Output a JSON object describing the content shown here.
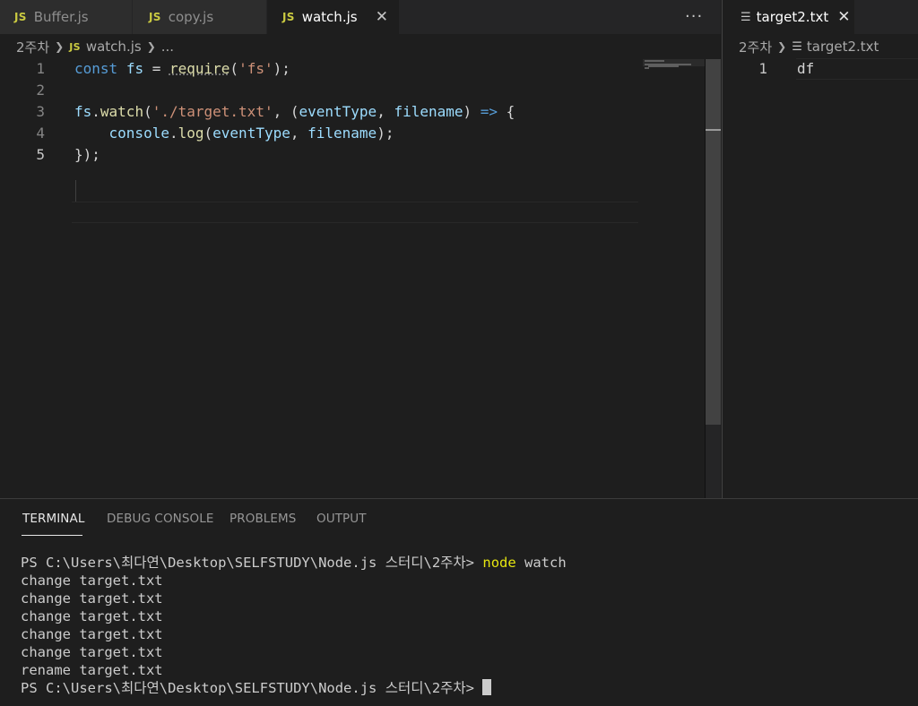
{
  "colors": {
    "editor_bg": "#1e1e1e",
    "tabbar_bg": "#252526",
    "inactive_tab_bg": "#2d2d2d",
    "js_badge": "#cbcb41",
    "keyword": "#569cd6",
    "variable": "#9cdcfe",
    "function": "#dcdcaa",
    "string": "#ce9178",
    "terminal_command": "#e5e510"
  },
  "left_editor": {
    "tabs": [
      {
        "badge": "JS",
        "label": "Buffer.js",
        "active": false
      },
      {
        "badge": "JS",
        "label": "copy.js",
        "active": false
      },
      {
        "badge": "JS",
        "label": "watch.js",
        "active": true,
        "close_icon": "close-icon"
      }
    ],
    "more_actions": "···",
    "breadcrumb": {
      "folder": "2주차",
      "separator_icon": "chevron-right-icon",
      "file_badge": "JS",
      "file": "watch.js",
      "ellipsis": "..."
    },
    "line_numbers": [
      "1",
      "2",
      "3",
      "4",
      "5"
    ],
    "code": {
      "l1": {
        "kw": "const",
        "sp1": " ",
        "var": "fs",
        "op": " = ",
        "fn": "require",
        "p1": "(",
        "str": "'fs'",
        "p2": ");"
      },
      "l3": {
        "obj": "fs",
        "dot": ".",
        "fn": "watch",
        "p1": "(",
        "str": "'./target.txt'",
        "c1": ", (",
        "a1": "eventType",
        "c2": ", ",
        "a2": "filename",
        "p2": ") ",
        "arrow": "=>",
        "brace": " {"
      },
      "l4": {
        "indent": "    ",
        "obj": "console",
        "dot": ".",
        "fn": "log",
        "p1": "(",
        "a1": "eventType",
        "c1": ", ",
        "a2": "filename",
        "p2": ");"
      },
      "l5": {
        "close": "});"
      }
    }
  },
  "right_editor": {
    "tab": {
      "icon": "file-lines-icon",
      "label": "target2.txt",
      "close": "✕"
    },
    "breadcrumb": {
      "folder": "2주차",
      "file": "target2.txt"
    },
    "line_numbers": [
      "1"
    ],
    "content": [
      "df"
    ]
  },
  "panel": {
    "tabs": [
      "TERMINAL",
      "DEBUG CONSOLE",
      "PROBLEMS",
      "OUTPUT"
    ],
    "active_tab": "TERMINAL",
    "terminal": {
      "prompt": "PS C:\\Users\\최다연\\Desktop\\SELFSTUDY\\Node.js 스터디\\2주차> ",
      "command": "node",
      "command_arg": " watch",
      "output": [
        "change target.txt",
        "change target.txt",
        "change target.txt",
        "change target.txt",
        "change target.txt",
        "rename target.txt"
      ],
      "final_prompt": "PS C:\\Users\\최다연\\Desktop\\SELFSTUDY\\Node.js 스터디\\2주차> "
    }
  }
}
